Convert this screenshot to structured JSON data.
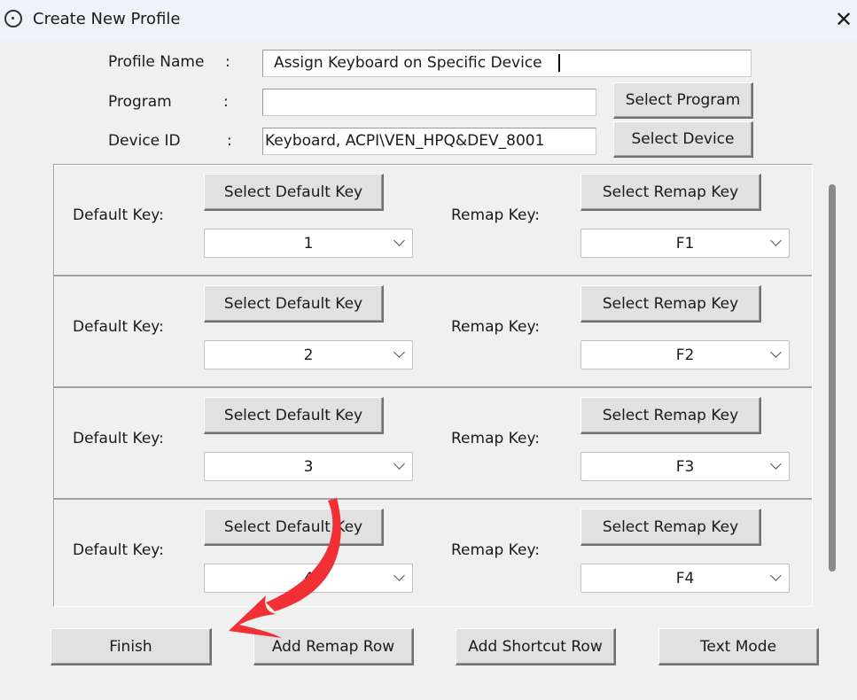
{
  "window": {
    "title": "Create New Profile",
    "close_icon": "close-icon"
  },
  "form": {
    "profile_name_label": "Profile Name",
    "program_label": "Program",
    "device_id_label": "Device ID",
    "colon": ":",
    "profile_name_value": "Assign Keyboard on Specific Device",
    "program_value": "",
    "device_id_value": "Keyboard, ACPI\\VEN_HPQ&DEV_8001",
    "select_program": "Select Program",
    "select_device": "Select Device"
  },
  "rows": [
    {
      "default_label": "Default Key:",
      "default_button": "Select Default Key",
      "default_value": "1",
      "remap_label": "Remap Key:",
      "remap_button": "Select Remap Key",
      "remap_value": "F1"
    },
    {
      "default_label": "Default Key:",
      "default_button": "Select Default Key",
      "default_value": "2",
      "remap_label": "Remap Key:",
      "remap_button": "Select Remap Key",
      "remap_value": "F2"
    },
    {
      "default_label": "Default Key:",
      "default_button": "Select Default Key",
      "default_value": "3",
      "remap_label": "Remap Key:",
      "remap_button": "Select Remap Key",
      "remap_value": "F3"
    },
    {
      "default_label": "Default Key:",
      "default_button": "Select Default Key",
      "default_value": "4",
      "remap_label": "Remap Key:",
      "remap_button": "Select Remap Key",
      "remap_value": "F4"
    }
  ],
  "footer": {
    "finish": "Finish",
    "add_remap_row": "Add Remap Row",
    "add_shortcut_row": "Add Shortcut Row",
    "text_mode": "Text Mode"
  },
  "annotation": {
    "arrow_color": "#f03034"
  }
}
